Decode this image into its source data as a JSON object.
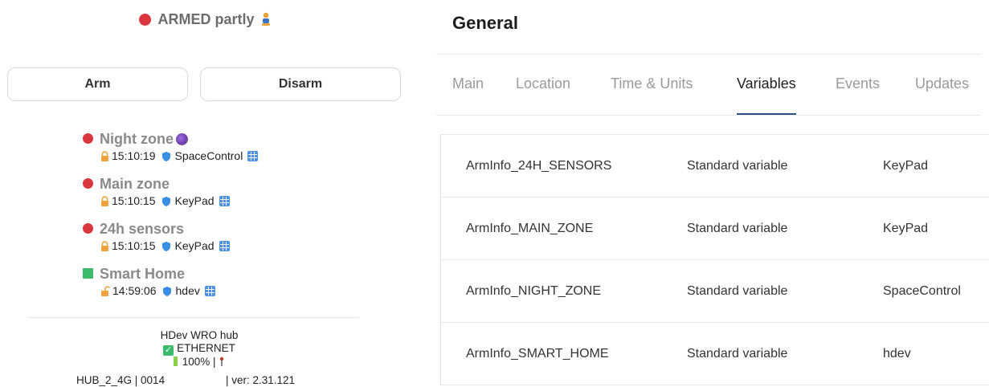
{
  "status": {
    "text": "ARMED partly"
  },
  "actions": {
    "arm_label": "Arm",
    "disarm_label": "Disarm"
  },
  "zones": [
    {
      "name": "Night zone",
      "time": "15:10:19",
      "source": "SpaceControl",
      "status_color": "#d9363e",
      "lock": "locked"
    },
    {
      "name": "Main zone",
      "time": "15:10:15",
      "source": "KeyPad",
      "status_color": "#d9363e",
      "lock": "locked"
    },
    {
      "name": "24h sensors",
      "time": "15:10:15",
      "source": "KeyPad",
      "status_color": "#d9363e",
      "lock": "locked"
    },
    {
      "name": "Smart Home",
      "time": "14:59:06",
      "source": "hdev",
      "status_color": "#3dbb6c",
      "lock": "unlocked"
    }
  ],
  "hub": {
    "name": "HDev WRO hub",
    "connection": "ETHERNET",
    "battery": "100%",
    "id_line": "HUB_2_4G | 0014",
    "version": "| ver: 2.31.121"
  },
  "general": {
    "title": "General",
    "tabs": [
      {
        "label": "Main"
      },
      {
        "label": "Location"
      },
      {
        "label": "Time & Units"
      },
      {
        "label": "Variables",
        "active": true
      },
      {
        "label": "Events"
      },
      {
        "label": "Updates"
      }
    ],
    "variables": [
      [
        "ArmInfo_24H_SENSORS",
        "Standard variable",
        "KeyPad"
      ],
      [
        "ArmInfo_MAIN_ZONE",
        "Standard variable",
        "KeyPad"
      ],
      [
        "ArmInfo_NIGHT_ZONE",
        "Standard variable",
        "SpaceControl"
      ],
      [
        "ArmInfo_SMART_HOME",
        "Standard variable",
        "hdev"
      ]
    ]
  },
  "colors": {
    "armed": "#d9363e",
    "disarmed": "#3dbb6c",
    "tab_underline": "#2d4f8a"
  }
}
